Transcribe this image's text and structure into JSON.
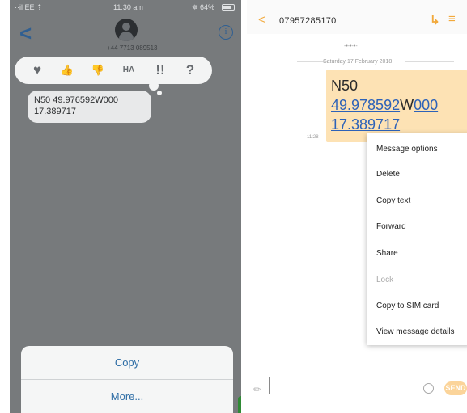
{
  "ios": {
    "status": {
      "left": "··il EE ⇡",
      "time": "11:30 am",
      "right": "✵ 64%"
    },
    "back_glyph": "<",
    "contact_number": "+44 7713 089513",
    "info_glyph": "i",
    "tapbacks": [
      {
        "icon": "heart-icon",
        "glyph": "♥"
      },
      {
        "icon": "thumbs-up-icon",
        "glyph": "👍"
      },
      {
        "icon": "thumbs-down-icon",
        "glyph": "👎"
      },
      {
        "icon": "haha-icon",
        "glyph": "HA"
      },
      {
        "icon": "exclamation-icon",
        "glyph": "!!"
      },
      {
        "icon": "question-icon",
        "glyph": "?"
      }
    ],
    "message": "N50 49.976592W000 17.389717",
    "sheet": {
      "copy": "Copy",
      "more": "More..."
    }
  },
  "android": {
    "title": "07957285170",
    "back_glyph": "<",
    "icons": {
      "call": "↳",
      "menu": "≡"
    },
    "date_divider": "-•-•-•-",
    "date_label": "Saturday 17 February 2018",
    "message": {
      "line1": "N50",
      "link1": "49.978592",
      "mid": "W",
      "link2": "000",
      "link3": "17.389717"
    },
    "time": "11:28",
    "menu": [
      {
        "label": "Message options",
        "disabled": false
      },
      {
        "label": "Delete",
        "disabled": false
      },
      {
        "label": "Copy text",
        "disabled": false
      },
      {
        "label": "Forward",
        "disabled": false
      },
      {
        "label": "Share",
        "disabled": false
      },
      {
        "label": "Lock",
        "disabled": true
      },
      {
        "label": "Copy to SIM card",
        "disabled": false
      },
      {
        "label": "View message details",
        "disabled": false
      }
    ],
    "send_label": "SEND"
  },
  "colors": {
    "ios_bg": "#777a7c",
    "ios_accent": "#2f5f92",
    "android_accent": "#f2a93b",
    "android_bubble": "#fde2b4",
    "link": "#2d62b8"
  }
}
